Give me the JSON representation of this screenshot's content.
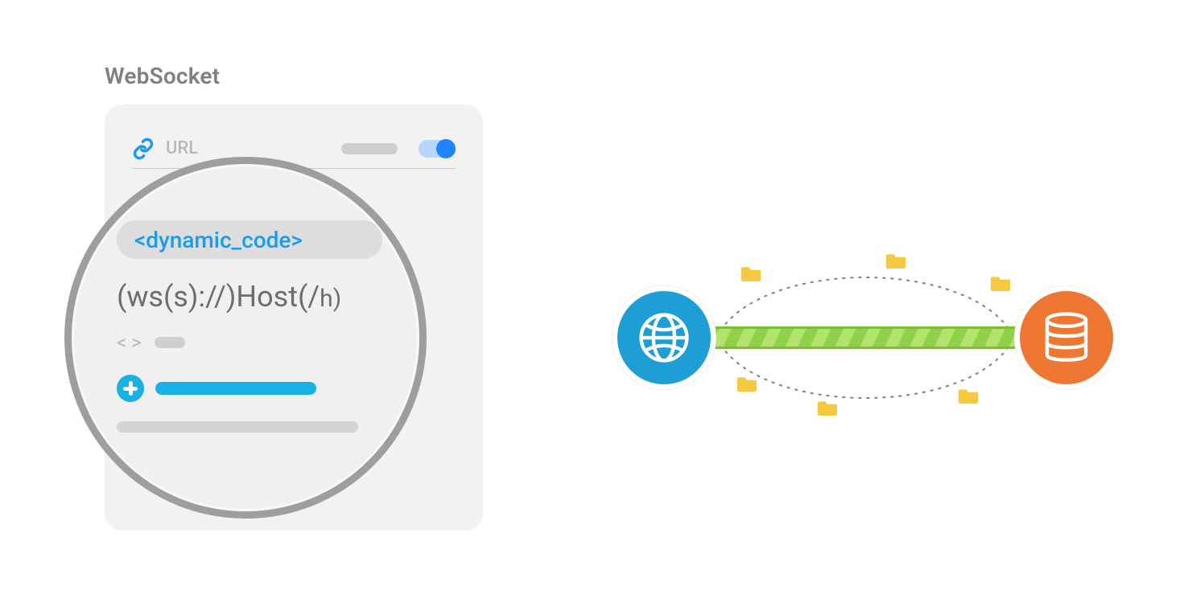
{
  "title": "WebSocket",
  "panel": {
    "url_label": "URL",
    "toggle_on": true
  },
  "lens": {
    "dynamic_code_chip": "<dynamic_code>",
    "url_pattern_main": "(ws(s)://)Host(/",
    "url_pattern_tail": "h)",
    "angle_brackets": "<  >"
  },
  "connection": {
    "left_node": "client-globe",
    "right_node": "server-database",
    "link_type": "websocket-duplex"
  },
  "colors": {
    "accent_blue": "#19b0e6",
    "accent_link": "#189cf0",
    "toggle_blue": "#1c85ff",
    "client_blue": "#1d9fd5",
    "server_orange": "#ee7733",
    "channel_green": "#8fd24a",
    "folder_yellow": "#f6c83f"
  }
}
